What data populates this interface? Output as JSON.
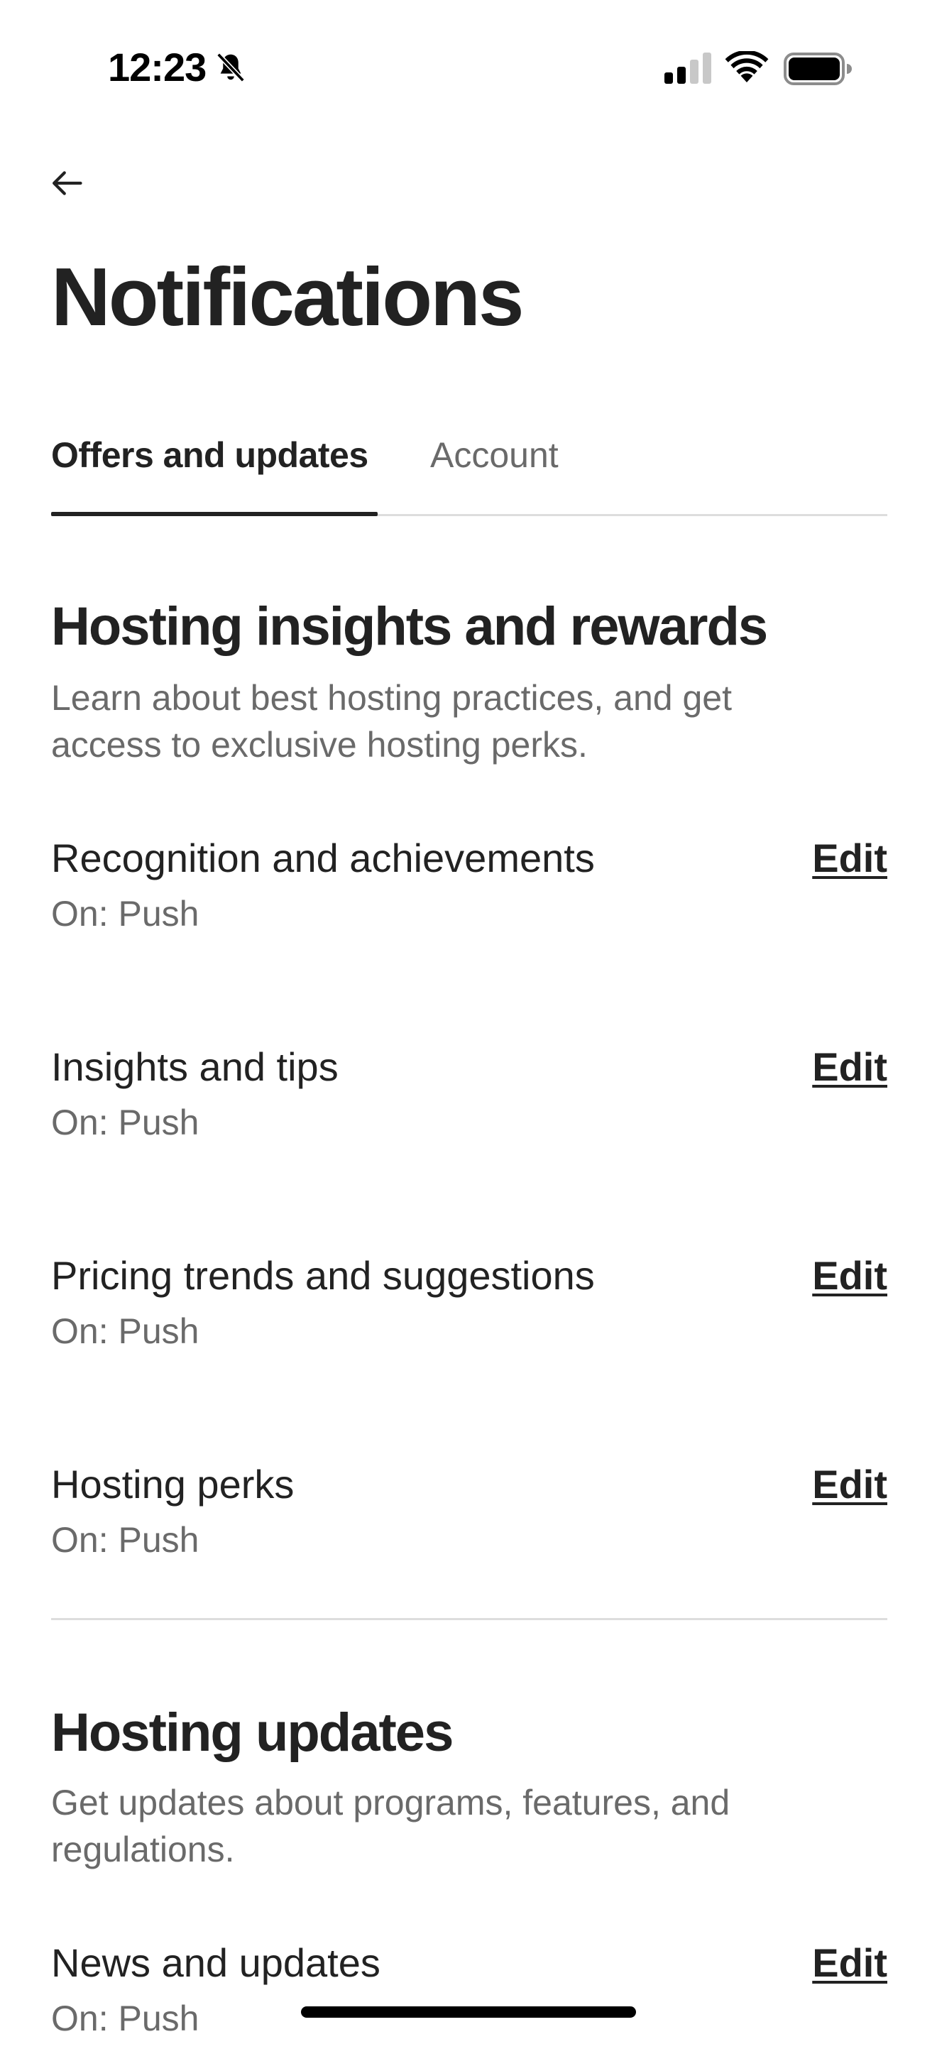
{
  "status_bar": {
    "time": "12:23",
    "icons": [
      "bell-off-icon",
      "cellular-signal-icon",
      "wifi-icon",
      "battery-icon"
    ]
  },
  "header": {
    "back_icon": "arrow-left-icon",
    "title": "Notifications"
  },
  "tabs": [
    {
      "label": "Offers and updates",
      "active": true
    },
    {
      "label": "Account",
      "active": false
    }
  ],
  "sections": [
    {
      "title": "Hosting insights and rewards",
      "description": "Learn about best hosting practices, and get access to exclusive hosting perks.",
      "items": [
        {
          "name": "Recognition and achievements",
          "status": "On: Push",
          "action": "Edit"
        },
        {
          "name": "Insights and tips",
          "status": "On: Push",
          "action": "Edit"
        },
        {
          "name": "Pricing trends and suggestions",
          "status": "On: Push",
          "action": "Edit"
        },
        {
          "name": "Hosting perks",
          "status": "On: Push",
          "action": "Edit"
        }
      ]
    },
    {
      "title": "Hosting updates",
      "description": "Get updates about programs, features, and regulations.",
      "items": [
        {
          "name": "News and updates",
          "status": "On: Push",
          "action": "Edit"
        }
      ]
    }
  ],
  "colors": {
    "text_primary": "#222222",
    "text_secondary": "#6a6a6a",
    "divider": "#dddddd",
    "background": "#ffffff"
  }
}
